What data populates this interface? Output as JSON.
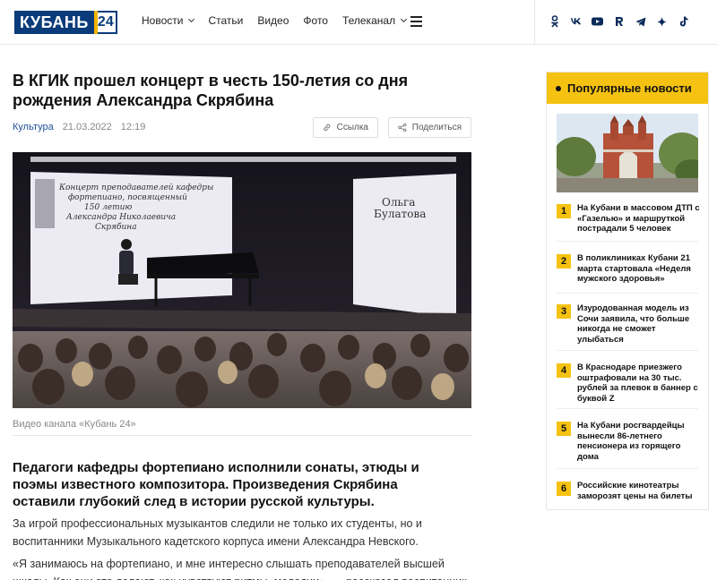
{
  "header": {
    "logo_text": "КУБАНЬ",
    "logo_num": "24",
    "nav": [
      {
        "label": "Новости",
        "has_dropdown": true
      },
      {
        "label": "Статьи",
        "has_dropdown": false
      },
      {
        "label": "Видео",
        "has_dropdown": false
      },
      {
        "label": "Фото",
        "has_dropdown": false
      },
      {
        "label": "Телеканал",
        "has_dropdown": true
      }
    ],
    "socials": [
      "ok",
      "vk",
      "youtube",
      "rutube",
      "telegram",
      "zen",
      "tiktok"
    ]
  },
  "article": {
    "title": "В КГИК прошел концерт в честь 150-летия со дня рождения Александра Скрябина",
    "category": "Культура",
    "date": "21.03.2022",
    "time": "12:19",
    "link_label": "Ссылка",
    "share_label": "Поделиться",
    "photo": {
      "screen_text": "Концерт преподавателей кафедры фортепиано, посвященный 150 летию Александра Николаевича Скрябина",
      "name_text": "Ольга Булатова"
    },
    "caption": "Видео канала «Кубань 24»",
    "lead": "Педагоги кафедры фортепиано исполнили сонаты, этюды и поэмы известного композитора. Произведения Скрябина оставили глубокий след в истории русской культуры.",
    "p1": "За игрой профессиональных музыкантов следили не только их студенты, но и воспитанники Музыкального кадетского корпуса имени Александра Невского.",
    "p2": "«Я занимаюсь на фортепиано, и мне интересно слышать преподавателей высшей школы. Как они это делают, как чувствуют ритмы, мелодии», — рассказал воспитанник"
  },
  "sidebar": {
    "title": "Популярные новости",
    "items": [
      {
        "num": "1",
        "text": "На Кубани в массовом ДТП с «Газелью» и маршруткой пострадали 5 человек"
      },
      {
        "num": "2",
        "text": "В поликлиниках Кубани 21 марта стартовала «Неделя мужского здоровья»"
      },
      {
        "num": "3",
        "text": "Изуродованная модель из Сочи заявила, что больше никогда не сможет улыбаться"
      },
      {
        "num": "4",
        "text": "В Краснодаре приезжего оштрафовали на 30 тыс. рублей за плевок в баннер с буквой Z"
      },
      {
        "num": "5",
        "text": "На Кубани росгвардейцы вынесли 86-летнего пенсионера из горящего дома"
      },
      {
        "num": "6",
        "text": "Российские кинотеатры заморозят цены на билеты"
      }
    ]
  },
  "colors": {
    "brand_blue": "#0a3b7a",
    "accent_yellow": "#f5c211",
    "link_blue": "#1d4f9a"
  }
}
